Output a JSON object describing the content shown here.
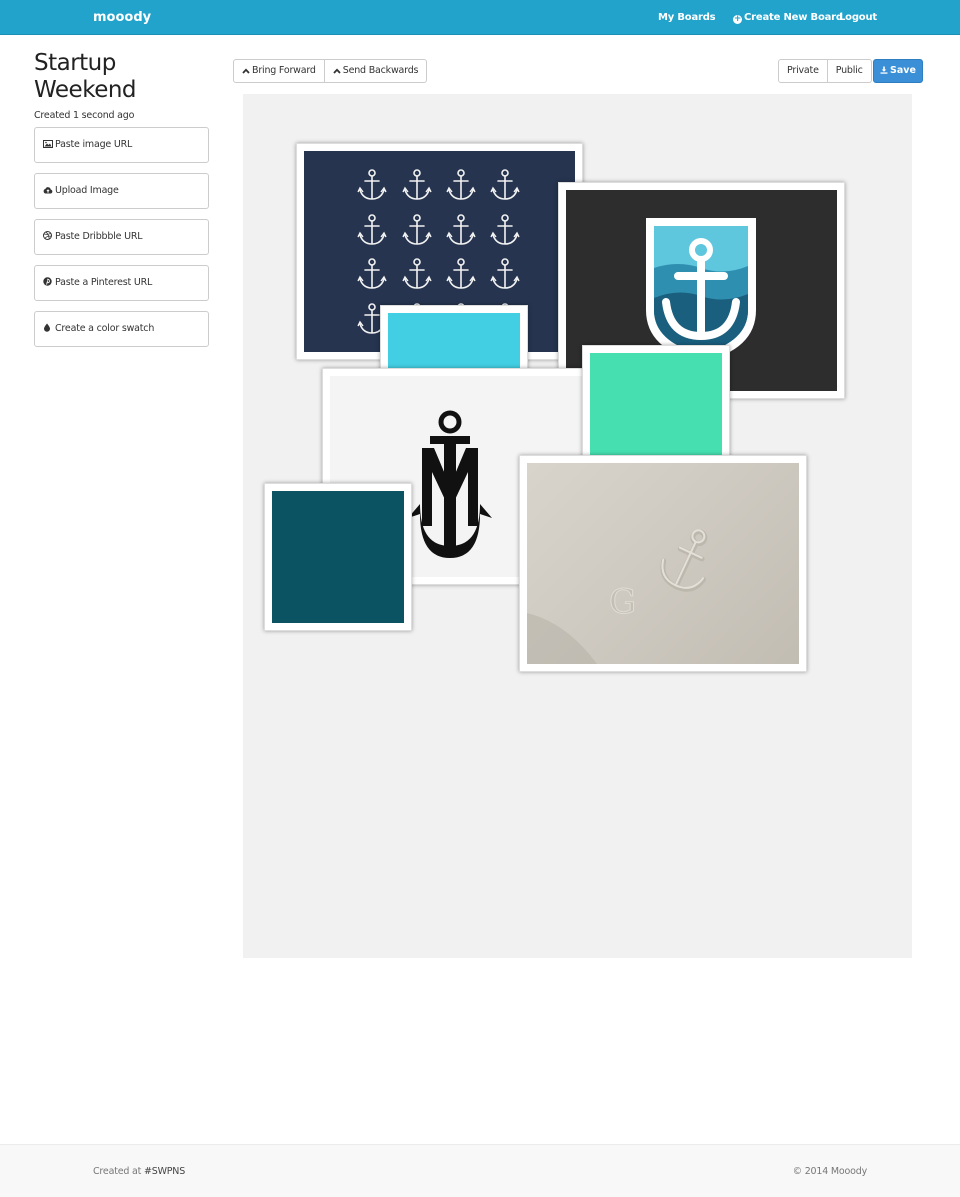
{
  "navbar": {
    "brand": "mooody",
    "my_boards": "My Boards",
    "create_new_board": "Create New Board",
    "logout": "Logout",
    "color": "#22a3cb"
  },
  "sidebar": {
    "title": "Startup Weekend",
    "created": "Created 1 second ago",
    "actions": [
      {
        "label": "Paste image URL",
        "icon": "image-icon"
      },
      {
        "label": "Upload Image",
        "icon": "cloud-upload-icon"
      },
      {
        "label": "Paste Dribbble URL",
        "icon": "dribbble-icon"
      },
      {
        "label": "Paste a Pinterest URL",
        "icon": "pinterest-icon"
      },
      {
        "label": "Create a color swatch",
        "icon": "tint-icon"
      }
    ]
  },
  "toolbar": {
    "bring_forward": "Bring Forward",
    "send_backwards": "Send Backwards",
    "private": "Private",
    "public": "Public",
    "save": "Save",
    "save_color": "#3b8fd6"
  },
  "board": {
    "swatches": [
      {
        "color": "#43cfe3"
      },
      {
        "color": "#46e0b0"
      },
      {
        "color": "#0b5263"
      }
    ],
    "images": [
      {
        "name": "anchor-sketches-navy"
      },
      {
        "name": "anchor-shield-logo"
      },
      {
        "name": "anchor-monogram-black"
      },
      {
        "name": "embossed-anchor-paper"
      }
    ]
  },
  "footer": {
    "created_at": "Created at",
    "tag": "#SWPNS",
    "copyright": "© 2014 Mooody"
  }
}
